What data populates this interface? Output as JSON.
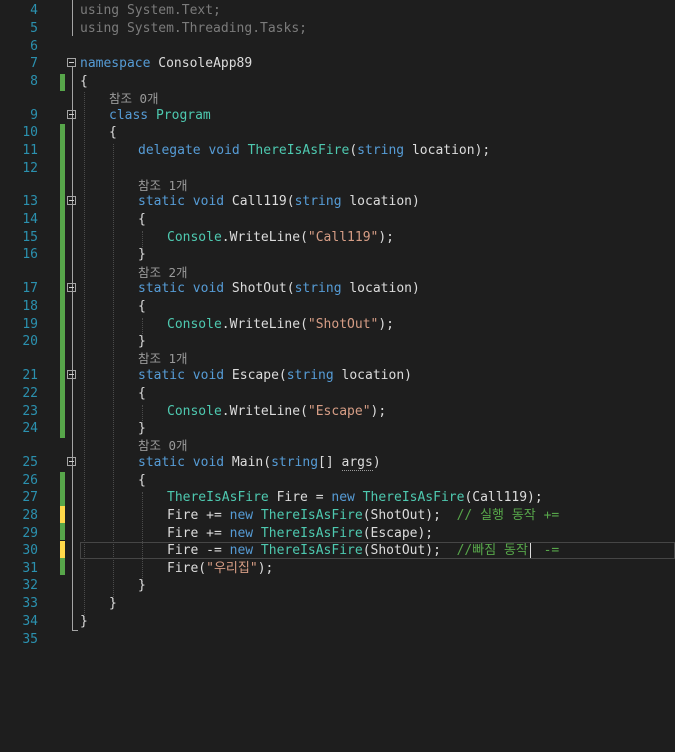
{
  "editor": {
    "theme_colors": {
      "background": "#1e1e1e",
      "line_number": "#2b91af",
      "keyword": "#569cd6",
      "type": "#4ec9b0",
      "string": "#d69d85",
      "comment": "#57a64a",
      "method": "#dcdcaa"
    },
    "line_numbers": [
      "4",
      "5",
      "6",
      "7",
      "8",
      "9",
      "10",
      "11",
      "12",
      "13",
      "14",
      "15",
      "16",
      "17",
      "18",
      "19",
      "20",
      "21",
      "22",
      "23",
      "24",
      "25",
      "26",
      "27",
      "28",
      "29",
      "30",
      "31",
      "32",
      "33",
      "34",
      "35"
    ],
    "codelens": {
      "program_refs": "참조 0개",
      "call119_refs": "참조 1개",
      "shotout_refs": "참조 2개",
      "escape_refs": "참조 1개",
      "main_refs": "참조 0개"
    },
    "code": {
      "l4_kw": "using",
      "l4_rest": " System.Text;",
      "l5_kw": "using",
      "l5_rest": " System.Threading.Tasks;",
      "l7_kw": "namespace",
      "l7_name": " ConsoleApp89",
      "brace_open": "{",
      "brace_close": "}",
      "l9_kw": "class",
      "l9_type": " Program",
      "l11_kw1": "delegate",
      "l11_kw2": " void",
      "l11_type": " ThereIsAsFire",
      "l11_p1": "(",
      "l11_kw3": "string",
      "l11_param": " location",
      "l11_end": ");",
      "l13_kw1": "static",
      "l13_kw2": " void",
      "l13_method": " Call119",
      "l13_p1": "(",
      "l13_kw3": "string",
      "l13_param": " location",
      "l13_end": ")",
      "l15_type": "Console",
      "l15_dot": ".",
      "l15_method": "WriteLine",
      "l15_p1": "(",
      "l15_str": "\"Call119\"",
      "l15_end": ");",
      "l17_kw1": "static",
      "l17_kw2": " void",
      "l17_method": " ShotOut",
      "l17_p1": "(",
      "l17_kw3": "string",
      "l17_param": " location",
      "l17_end": ")",
      "l19_type": "Console",
      "l19_dot": ".",
      "l19_method": "WriteLine",
      "l19_p1": "(",
      "l19_str": "\"ShotOut\"",
      "l19_end": ");",
      "l21_kw1": "static",
      "l21_kw2": " void",
      "l21_method": " Escape",
      "l21_p1": "(",
      "l21_kw3": "string",
      "l21_param": " location",
      "l21_end": ")",
      "l23_type": "Console",
      "l23_dot": ".",
      "l23_method": "WriteLine",
      "l23_p1": "(",
      "l23_str": "\"Escape\"",
      "l23_end": ");",
      "l25_kw1": "static",
      "l25_kw2": " void",
      "l25_method": " Main",
      "l25_p1": "(",
      "l25_kw3": "string",
      "l25_arr": "[] ",
      "l25_param": "args",
      "l25_end": ")",
      "l27_type": "ThereIsAsFire",
      "l27_var": " Fire = ",
      "l27_kw": "new",
      "l27_type2": " ThereIsAsFire",
      "l27_arg": "(Call119);",
      "l28_var": "Fire += ",
      "l28_kw": "new",
      "l28_type": " ThereIsAsFire",
      "l28_arg": "(ShotOut);  ",
      "l28_cm": "// 실행 동작 +=",
      "l29_var": "Fire += ",
      "l29_kw": "new",
      "l29_type": " ThereIsAsFire",
      "l29_arg": "(Escape);",
      "l30_var": "Fire -= ",
      "l30_kw": "new",
      "l30_type": " ThereIsAsFire",
      "l30_arg": "(ShotOut);  ",
      "l30_cm": "//빠짐 동작  -=",
      "l31_call": "Fire(",
      "l31_str": "\"우리집\"",
      "l31_end": ");"
    }
  }
}
